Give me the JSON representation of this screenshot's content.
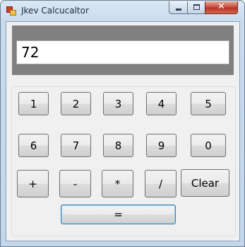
{
  "window": {
    "title": "Jkev Calcucaltor"
  },
  "titlebar_buttons": {
    "minimize": "",
    "maximize": "",
    "close": "✕"
  },
  "display": {
    "value": "72"
  },
  "keypad": {
    "row1": [
      "1",
      "2",
      "3",
      "4",
      "5"
    ],
    "row2": [
      "6",
      "7",
      "8",
      "9",
      "0"
    ],
    "row3": [
      "+",
      "-",
      "*",
      "/",
      "Clear"
    ],
    "equals": "="
  },
  "colors": {
    "display_panel": "#808080",
    "client": "#f0f0f0",
    "equals_focus_border": "#3c7fb1"
  }
}
